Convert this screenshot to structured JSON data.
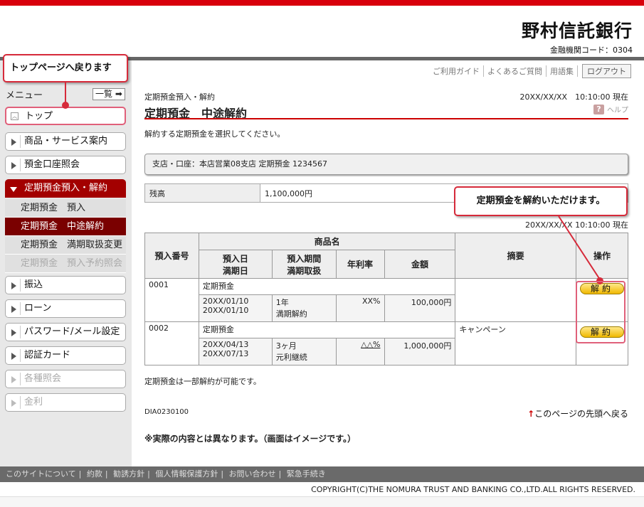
{
  "header": {
    "bank_name": "野村信託銀行",
    "bank_code": "金融機関コード：0304",
    "util_links": [
      "ご利用ガイド",
      "よくあるご質問",
      "用語集"
    ],
    "logout": "ログアウト"
  },
  "sidebar": {
    "menu_label": "メニュー",
    "ichiran": "一覧",
    "items": [
      {
        "label": "トップ"
      },
      {
        "label": "商品・サービス案内"
      },
      {
        "label": "預金口座照会"
      },
      {
        "label": "定期預金預入・解約"
      },
      {
        "label": "振込"
      },
      {
        "label": "ローン"
      },
      {
        "label": "パスワード/メール設定"
      },
      {
        "label": "認証カード"
      },
      {
        "label": "各種照会"
      },
      {
        "label": "金利"
      }
    ],
    "subitems": [
      "定期預金　預入",
      "定期預金　中途解約",
      "定期預金　満期取扱変更",
      "定期預金　預入予約照会"
    ]
  },
  "callouts": {
    "top": "トップページへ戻ります",
    "cancel": "定期預金を解約いただけます。"
  },
  "main": {
    "breadcrumb": "定期預金預入・解約",
    "datetime": "20XX/XX/XX　10:10:00 現在",
    "title": "定期預金　中途解約",
    "help": "ヘルプ",
    "instruction": "解約する定期預金を選択してください。",
    "account": "支店・口座：本店営業08支店 定期預金 1234567",
    "balance_label": "残高",
    "balance_value": "1,100,000円",
    "datetime2": "20XX/XX/XX 10:10:00 現在",
    "table": {
      "h_no": "預入番号",
      "h_product": "商品名",
      "h_date1": "預入日",
      "h_date2": "満期日",
      "h_term1": "預入期間",
      "h_term2": "満期取扱",
      "h_rate": "年利率",
      "h_amount": "金額",
      "h_memo": "摘要",
      "h_action": "操作",
      "rows": [
        {
          "no": "0001",
          "product": "定期預金",
          "date1": "20XX/01/10",
          "date2": "20XX/01/10",
          "term1": "1年",
          "term2": "満期解約",
          "rate": "XX%",
          "amount": "100,000円",
          "memo": "",
          "action": "解約"
        },
        {
          "no": "0002",
          "product": "定期預金",
          "date1": "20XX/04/13",
          "date2": "20XX/07/13",
          "term1": "3ヶ月",
          "term2": "元利継続",
          "rate": "△△%",
          "amount": "1,000,000円",
          "memo": "キャンペーン",
          "action": "解約"
        }
      ]
    },
    "note": "定期預金は一部解約が可能です。",
    "page_id": "DIA0230100",
    "to_top": "このページの先頭へ戻る",
    "disclaimer": "※実際の内容とは異なります。（画面はイメージです。）"
  },
  "footer": {
    "links": [
      "このサイトについて",
      "約款",
      "勧誘方針",
      "個人情報保護方針",
      "お問い合わせ",
      "緊急手続き"
    ],
    "copyright": "COPYRIGHT(C)THE NOMURA TRUST AND BANKING CO.,LTD.ALL RIGHTS RESERVED."
  }
}
